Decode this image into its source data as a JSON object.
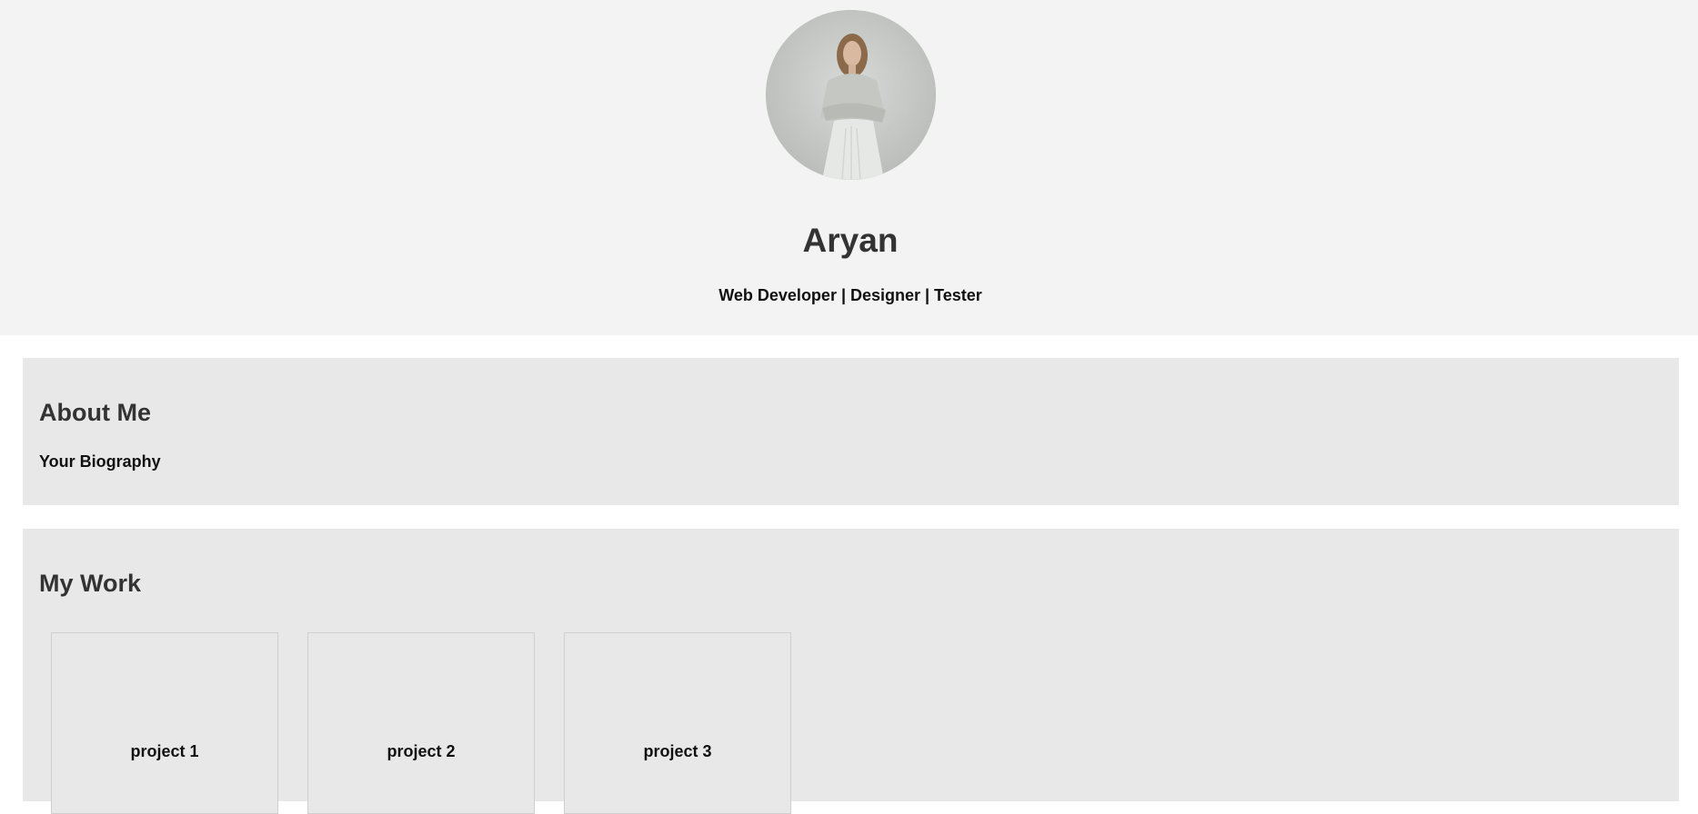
{
  "header": {
    "avatar_icon": "profile-photo",
    "name": "Aryan",
    "tagline": "Web Developer | Designer | Tester"
  },
  "about": {
    "title": "About Me",
    "bio": "Your Biography"
  },
  "work": {
    "title": "My Work",
    "projects": [
      {
        "title": "project 1"
      },
      {
        "title": "project 2"
      },
      {
        "title": "project 3"
      }
    ]
  },
  "colors": {
    "header_bg": "#f3f3f3",
    "section_bg": "#e8e8e8",
    "heading_text": "#333333",
    "body_text": "#111111"
  }
}
